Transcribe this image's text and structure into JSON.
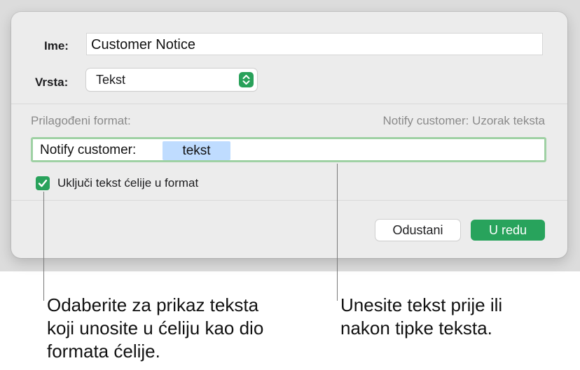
{
  "dialog": {
    "name_label": "Ime:",
    "name_value": "Customer Notice",
    "type_label": "Vrsta:",
    "type_value": "Tekst",
    "custom_format_label": "Prilagođeni format:",
    "preview_text": "Notify customer: Uzorak teksta",
    "format_prefix": "Notify customer:",
    "format_token": "tekst",
    "include_checkbox_label": "Uključi tekst ćelije u format",
    "include_checked": true,
    "cancel_label": "Odustani",
    "ok_label": "U redu",
    "accent_color": "#28a35c"
  },
  "callouts": {
    "left": [
      "Odaberite za prikaz teksta",
      "koji unosite u ćeliju kao dio",
      "formata ćelije."
    ],
    "right": [
      "Unesite tekst prije ili",
      "nakon tipke teksta."
    ]
  }
}
